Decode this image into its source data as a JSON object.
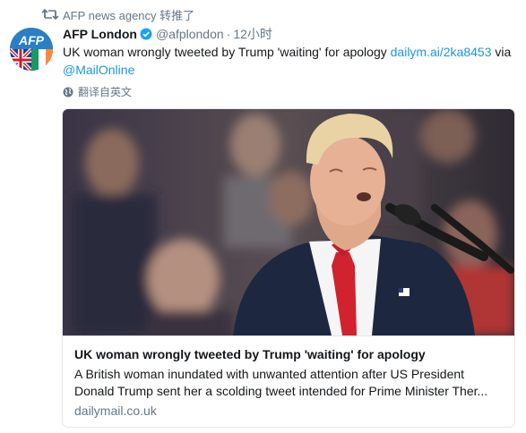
{
  "retweet": {
    "icon": "retweet-icon",
    "text": "AFP news agency 转推了"
  },
  "author": {
    "avatar_icon": "afp-london-avatar",
    "avatar_logo_text": "AFP",
    "name": "AFP London",
    "verified_icon": "verified-badge-icon",
    "handle": "@afplondon",
    "separator": "·",
    "time": "12小时"
  },
  "tweet": {
    "text_before_link": "UK woman wrongly tweeted by Trump 'waiting' for apology ",
    "link": "dailym.ai/2ka8453",
    "text_after_link": " via ",
    "mention": "@MailOnline"
  },
  "translate": {
    "icon": "globe-icon",
    "label": "翻译自英文"
  },
  "card": {
    "image_icon": "article-photo",
    "title": "UK woman wrongly tweeted by Trump 'waiting' for apology",
    "description": "A British woman inundated with unwanted attention after US President Donald Trump sent her a scolding tweet intended for Prime Minister Ther...",
    "domain": "dailymail.co.uk"
  },
  "colors": {
    "link": "#1b95e0",
    "secondary_text": "#657786",
    "primary_text": "#14171a",
    "border": "#e1e8ed",
    "verified": "#1da1f2",
    "avatar_bg": "#2a7fc4"
  }
}
